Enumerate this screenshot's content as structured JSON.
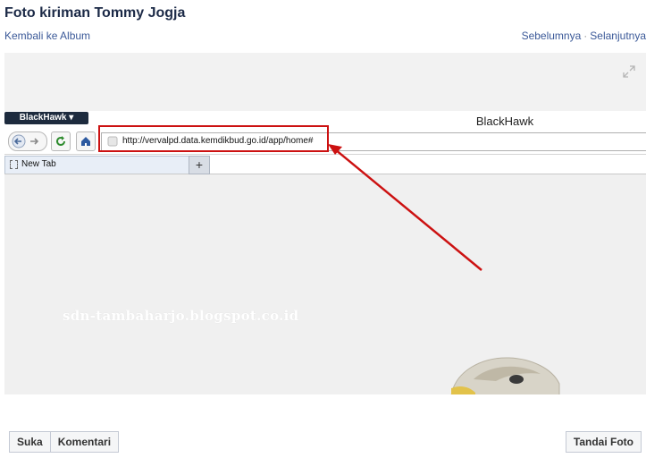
{
  "header": {
    "title": "Foto kiriman Tommy Jogja",
    "back_link": "Kembali ke Album",
    "prev_link": "Sebelumnya",
    "separator": "·",
    "next_link": "Selanjutnya"
  },
  "photo": {
    "browser_menu": "BlackHawk",
    "browser_title": "BlackHawk",
    "address_url": "http://vervalpd.data.kemdikbud.go.id/app/home#",
    "tab_label": "New Tab",
    "new_tab_symbol": "+",
    "watermark": "sdn-tambaharjo.blogspot.co.id",
    "highlight_color": "#cc1111"
  },
  "actions": {
    "like": "Suka",
    "comment": "Komentari",
    "tag": "Tandai Foto"
  }
}
